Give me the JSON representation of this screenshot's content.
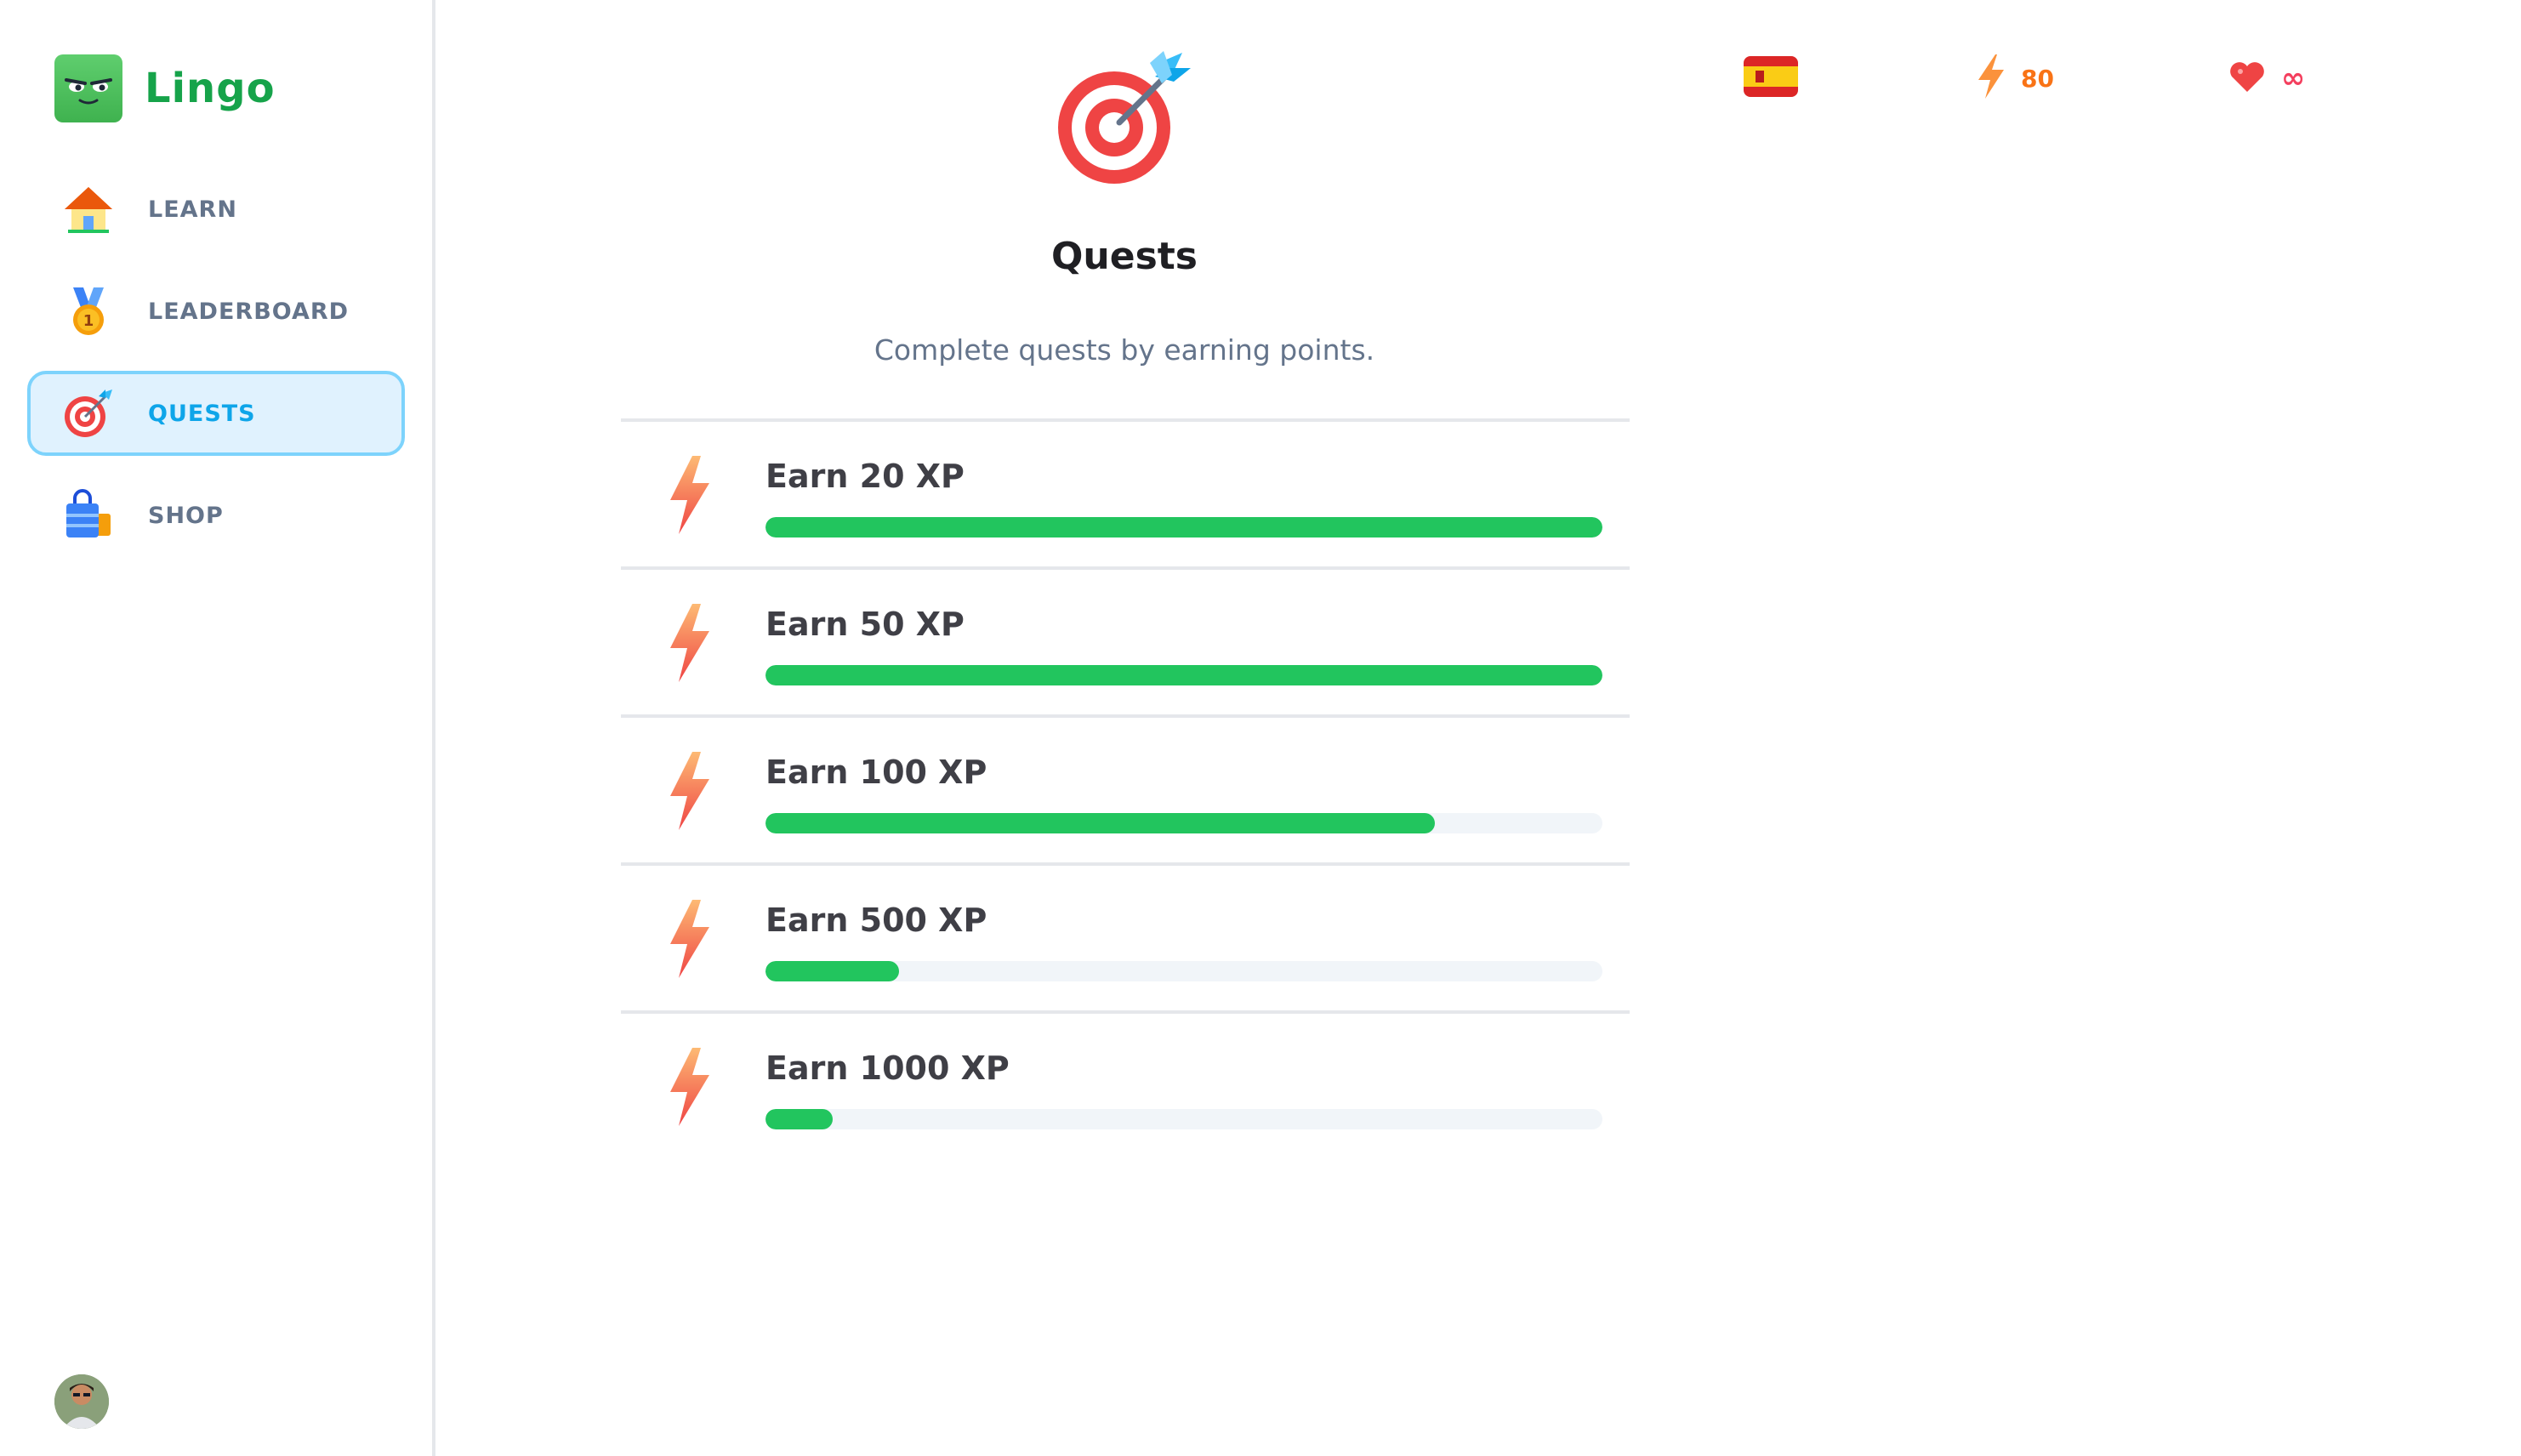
{
  "app": {
    "name": "Lingo",
    "brand_color": "#16a34a"
  },
  "sidebar": {
    "items": [
      {
        "id": "learn",
        "label": "LEARN",
        "icon": "house-icon",
        "active": false
      },
      {
        "id": "leaderboard",
        "label": "LEADERBOARD",
        "icon": "medal-icon",
        "active": false
      },
      {
        "id": "quests",
        "label": "QUESTS",
        "icon": "target-icon",
        "active": true
      },
      {
        "id": "shop",
        "label": "SHOP",
        "icon": "shopping-bag-icon",
        "active": false
      }
    ],
    "user_avatar": "avatar"
  },
  "header": {
    "language_flag": "spain-flag-icon",
    "points": "80",
    "points_color": "#f97316",
    "hearts": "∞",
    "hearts_color": "#f43f5e"
  },
  "main": {
    "title": "Quests",
    "subtitle": "Complete quests by earning points.",
    "icon": "target-icon"
  },
  "quests": [
    {
      "title": "Earn 20 XP",
      "progress": 1.0
    },
    {
      "title": "Earn 50 XP",
      "progress": 1.0
    },
    {
      "title": "Earn 100 XP",
      "progress": 0.8
    },
    {
      "title": "Earn 500 XP",
      "progress": 0.16
    },
    {
      "title": "Earn 1000 XP",
      "progress": 0.08
    }
  ],
  "colors": {
    "progress_fill": "#22c55e",
    "progress_track": "#f1f5f9",
    "active_nav_bg": "#e0f2fe",
    "active_nav_border": "#7dd3fc",
    "active_nav_text": "#0ea5e9"
  }
}
